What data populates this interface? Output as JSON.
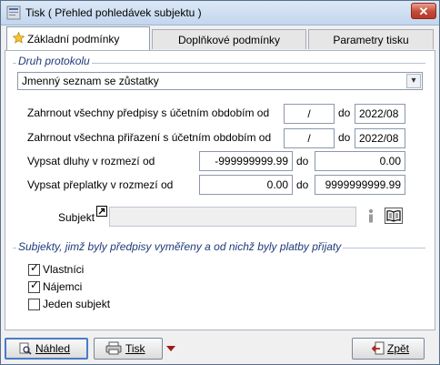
{
  "window": {
    "title": "Tisk ( Přehled pohledávek subjektu )",
    "close_label": "✕"
  },
  "tabs": [
    {
      "label": "Základní podmínky",
      "active": true
    },
    {
      "label": "Doplňkové podmínky",
      "active": false
    },
    {
      "label": "Parametry tisku",
      "active": false
    }
  ],
  "protocol": {
    "group_label": "Druh protokolu",
    "selected": "Jmenný seznam se zůstatky"
  },
  "rows": {
    "predpisy": {
      "label": "Zahrnout všechny předpisy s účetním obdobím od",
      "from": "/",
      "to_label": "do",
      "to": "2022/08"
    },
    "prirazeni": {
      "label": "Zahrnout všechna přiřazení s účetním obdobím od",
      "from": "/",
      "to_label": "do",
      "to": "2022/08"
    },
    "dluhy": {
      "label": "Vypsat dluhy v rozmezí od",
      "from": "-999999999.99",
      "to_label": "do",
      "to": "0.00"
    },
    "preplatky": {
      "label": "Vypsat přeplatky v rozmezí od",
      "from": "0.00",
      "to_label": "do",
      "to": "9999999999.99"
    }
  },
  "subject": {
    "label": "Subjekt",
    "value": ""
  },
  "subjects_group": {
    "group_label": "Subjekty, jimž byly předpisy vyměřeny a od nichž byly platby přijaty",
    "options": [
      {
        "label": "Vlastníci",
        "checked": true
      },
      {
        "label": "Nájemci",
        "checked": true
      },
      {
        "label": "Jeden subjekt",
        "checked": false
      }
    ]
  },
  "buttons": {
    "preview": "Náhled",
    "print": "Tisk",
    "back": "Zpět"
  },
  "colors": {
    "group_label": "#1f3a7a",
    "default_button_border": "#4a7bc8"
  }
}
